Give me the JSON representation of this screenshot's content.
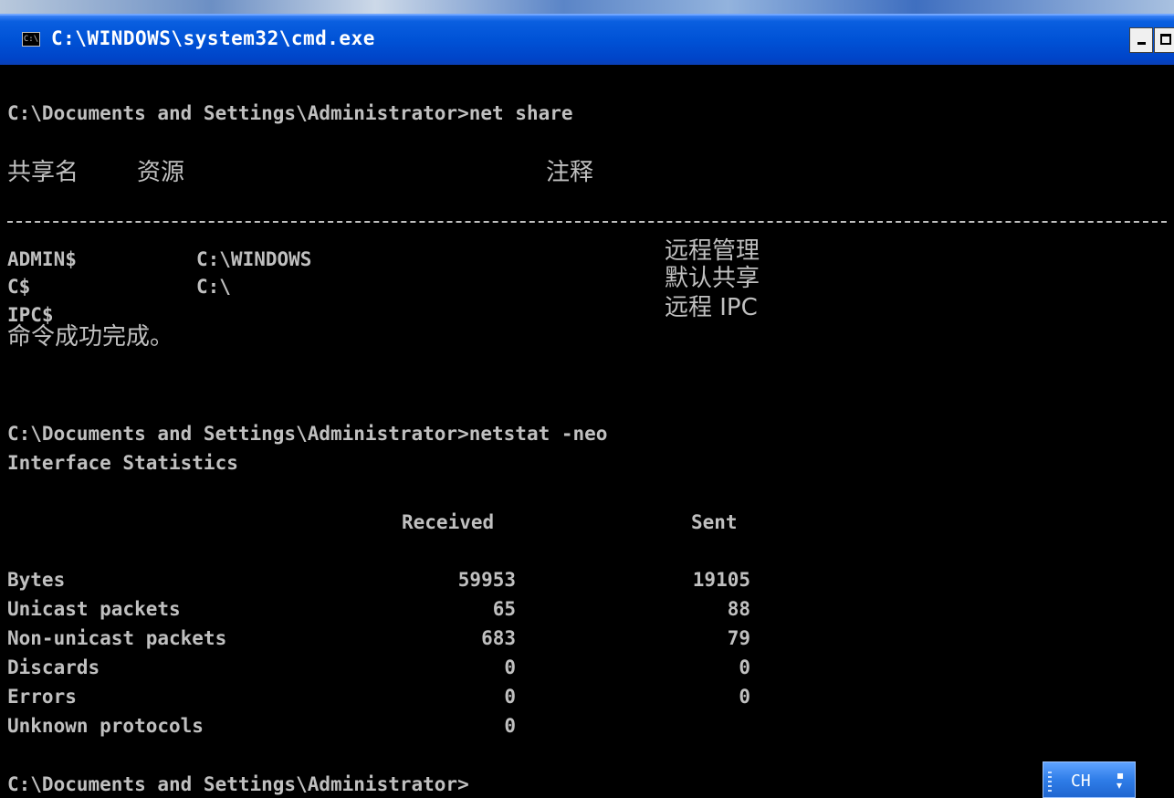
{
  "window": {
    "title": "C:\\WINDOWS\\system32\\cmd.exe",
    "icon": "console-icon"
  },
  "console": {
    "cmd1": "C:\\Documents and Settings\\Administrator>net share",
    "share_header": {
      "name": "共享名",
      "resource": "资源",
      "remark": "注释"
    },
    "shares": [
      {
        "name": "ADMIN$",
        "resource": "C:\\WINDOWS",
        "remark": "远程管理"
      },
      {
        "name": "C$",
        "resource": "C:\\",
        "remark": "默认共享"
      },
      {
        "name": "IPC$",
        "resource": "",
        "remark": "远程 IPC"
      }
    ],
    "success": "命令成功完成。",
    "cmd2": "C:\\Documents and Settings\\Administrator>netstat -neo",
    "stats_title": "Interface Statistics",
    "stats_header": {
      "received": "Received",
      "sent": "Sent"
    },
    "stats": [
      {
        "label": "Bytes",
        "received": "59953",
        "sent": "19105"
      },
      {
        "label": "Unicast packets",
        "received": "65",
        "sent": "88"
      },
      {
        "label": "Non-unicast packets",
        "received": "683",
        "sent": "79"
      },
      {
        "label": "Discards",
        "received": "0",
        "sent": "0"
      },
      {
        "label": "Errors",
        "received": "0",
        "sent": "0"
      },
      {
        "label": "Unknown protocols",
        "received": "0",
        "sent": ""
      }
    ],
    "prompt": "C:\\Documents and Settings\\Administrator>"
  },
  "ime": {
    "label": "CH"
  }
}
